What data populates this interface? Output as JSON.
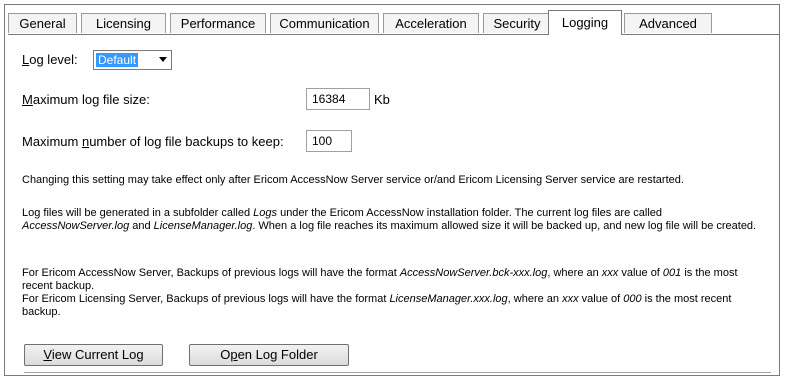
{
  "tabs": [
    {
      "label": "General"
    },
    {
      "label": "Licensing"
    },
    {
      "label": "Performance"
    },
    {
      "label": "Communication"
    },
    {
      "label": "Acceleration"
    },
    {
      "label": "Security"
    },
    {
      "label": "Logging",
      "active": true
    },
    {
      "label": "Advanced"
    }
  ],
  "log_level": {
    "mnemonic": "L",
    "label_rest": "og level:",
    "value": "Default"
  },
  "max_size": {
    "mnemonic": "M",
    "label_rest": "aximum log file size:",
    "value": "16384",
    "unit": "Kb"
  },
  "max_backups": {
    "pre": "Maximum ",
    "mnemonic": "n",
    "label_rest": "umber of log file backups to keep:",
    "value": "100"
  },
  "notes": {
    "restart": "Changing this setting may take effect only after Ericom AccessNow Server service or/and Ericom Licensing Server service are restarted.",
    "p2_a": "Log files will be generated in a subfolder called ",
    "p2_b": "Logs",
    "p2_c": " under the Ericom AccessNow installation folder. The current log files are called ",
    "p2_d": "AccessNowServer.log",
    "p2_e": " and ",
    "p2_f": "LicenseManager.log",
    "p2_g": ". When a log file reaches its maximum allowed size it will be backed up, and new log file will be created.",
    "p3_a": "For Ericom AccessNow Server, Backups of previous logs will have the format ",
    "p3_b": "AccessNowServer.bck-xxx.log",
    "p3_c": ", where an ",
    "p3_d": "xxx",
    "p3_e": " value of ",
    "p3_f": "001",
    "p3_g": " is the most recent backup.",
    "p4_a": "For Ericom Licensing Server, Backups of previous logs will have the format ",
    "p4_b": "LicenseManager.xxx.log",
    "p4_c": ", where an ",
    "p4_d": "xxx",
    "p4_e": " value of ",
    "p4_f": "000",
    "p4_g": " is the most recent backup."
  },
  "buttons": {
    "view_mnemonic": "V",
    "view_rest": "iew Current Log",
    "open_pre": "O",
    "open_mnemonic": "p",
    "open_rest": "en Log Folder"
  }
}
